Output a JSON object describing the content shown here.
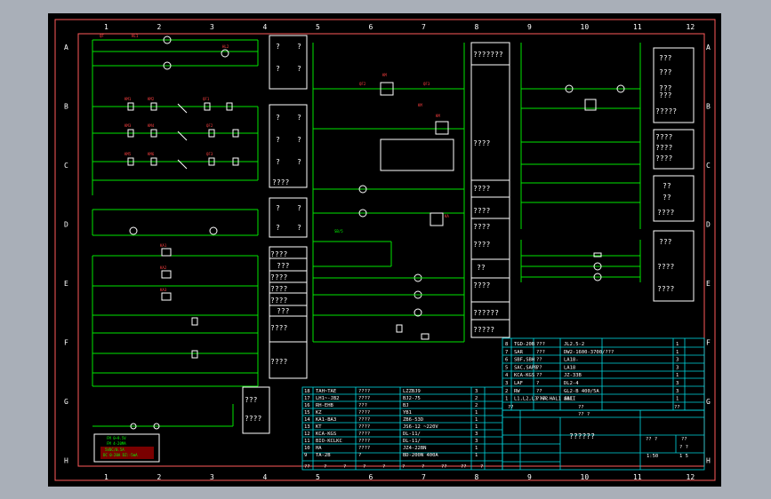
{
  "colors": {
    "background": "#000000",
    "border": "#ff5a5a",
    "wire": "#00e600",
    "component": "#ffffff",
    "label_red": "#ff4040",
    "label_green": "#00ff00",
    "table_line": "#00d8e0",
    "text": "#ffffff"
  },
  "grid": {
    "columns": [
      "1",
      "2",
      "3",
      "4",
      "5",
      "6",
      "7",
      "8",
      "9",
      "10",
      "11",
      "12"
    ],
    "rows": [
      "A",
      "B",
      "C",
      "D",
      "E",
      "F",
      "G",
      "H"
    ]
  },
  "annotations": {
    "panel_left_1": [
      "?",
      "?",
      "?",
      "?"
    ],
    "panel_left_2": [
      "?",
      "?",
      "?",
      "?",
      "?",
      "?",
      "????"
    ],
    "panel_left_3": [
      "?",
      "?",
      "?",
      "?"
    ],
    "panel_left_4": [
      "????",
      "???",
      "????",
      "????",
      "????",
      "???",
      "????",
      "????"
    ],
    "panel_center": [
      "???????",
      "????",
      "????",
      "????",
      "????",
      "????",
      "??",
      "????",
      "??????",
      "?????"
    ],
    "panel_right_1": [
      "???",
      "???",
      "???",
      "???",
      "?????"
    ],
    "panel_right_2": [
      "????",
      "????",
      "????"
    ],
    "panel_right_3": [
      "??",
      "??",
      "????"
    ],
    "panel_right_4": [
      "???",
      "????",
      "????"
    ],
    "bottom_left_box": [
      "???",
      "????"
    ],
    "red_note": [
      "FM  0~9.5V",
      "FM  4-20MA",
      "5VDC/0.5A",
      "DC  0-20A DZ:-5mA"
    ]
  },
  "bom_right": {
    "rows": [
      [
        "8",
        "TGD-20B",
        "???",
        "JL2.5-2",
        "1"
      ],
      [
        "7",
        "SAR",
        "???",
        "DW2-1600-3700/???",
        "1"
      ],
      [
        "6",
        "SBF,SBH",
        "??",
        "LA18-",
        "3"
      ],
      [
        "5",
        "SAC,SAPB",
        "??",
        "LA18",
        "3"
      ],
      [
        "4",
        "KCA-KGS",
        "??",
        "JZ-33B",
        "1"
      ],
      [
        "3",
        "LAF",
        "?",
        "DL2-4",
        "3"
      ],
      [
        "2",
        "RW",
        "??",
        "GL2-B 400/5A",
        "3"
      ],
      [
        "1",
        "L1,L2,L3 HA,HAL1 SAL",
        "????",
        "ABII",
        "1"
      ]
    ],
    "footer": [
      "??",
      "??",
      "??"
    ]
  },
  "bom_left": {
    "rows": [
      [
        "18",
        "TAH~TAE",
        "????",
        "LZZBJ9",
        "3"
      ],
      [
        "17",
        "LH1~-JB2",
        "????",
        "BJ2-75",
        "2"
      ],
      [
        "16",
        "RH-EHB",
        "???",
        "BJ",
        "2"
      ],
      [
        "15",
        "KZ",
        "????",
        "YB1",
        "1"
      ],
      [
        "14",
        "KA1-BA3",
        "????",
        "ZB6-53D",
        "1"
      ],
      [
        "13",
        "KT",
        "????",
        "JS6-12 ~220V",
        "1"
      ],
      [
        "12",
        "KCA-KGS",
        "????",
        "DL-11/",
        "3"
      ],
      [
        "11",
        "BIO-KCLKC",
        "????",
        "DL-11/",
        "3"
      ],
      [
        "10",
        "HA",
        "????",
        "JZ4-22BN",
        "1"
      ],
      [
        "9",
        "TA-2B",
        "?",
        "BD-200N 400A",
        "1"
      ]
    ],
    "footer": [
      "??",
      "?",
      "?",
      "?",
      "?",
      "?",
      "?",
      "??",
      "??",
      "?"
    ]
  },
  "title_block": {
    "name": "??????",
    "qty_label": "?? ?",
    "scale_label": "??",
    "scale": "1:50",
    "sheet_label": "? ?",
    "sheet_value": "1 5",
    "page_label": "?? ?"
  }
}
